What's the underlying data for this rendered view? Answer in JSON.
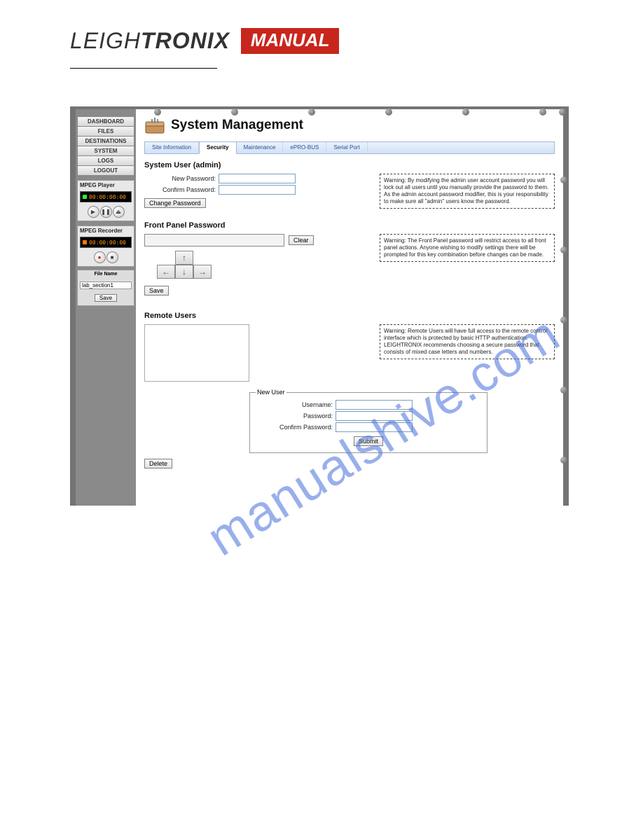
{
  "brand": {
    "thin": "LEIGH",
    "bold": "TRONIX",
    "badge": "MANUAL"
  },
  "watermark": "manualshive.com",
  "sidebar": {
    "nav": [
      "DASHBOARD",
      "FILES",
      "DESTINATIONS",
      "SYSTEM",
      "LOGS",
      "LOGOUT"
    ],
    "player": {
      "title": "MPEG Player",
      "time": "00:00:00:00",
      "controls": [
        "play",
        "pause",
        "eject"
      ]
    },
    "recorder": {
      "title": "MPEG Recorder",
      "time": "00:00:00:00",
      "controls": [
        "record",
        "stop"
      ]
    },
    "filebox": {
      "label": "File Name",
      "value": "lab_section1",
      "save": "Save"
    }
  },
  "page_title": "System Management",
  "tabs": [
    "Site Information",
    "Security",
    "Maintenance",
    "ePRO-BUS",
    "Serial Port"
  ],
  "active_tab": 1,
  "system_user": {
    "heading": "System User (admin)",
    "new_pw_label": "New Password:",
    "confirm_pw_label": "Confirm Password:",
    "change_btn": "Change Password",
    "warning": "Warning: By modifying the admin user account password you will lock out all users until you manually provide the password to them. As the admin account password modifier, this is your responsibility to make sure all \"admin\" users know the password."
  },
  "front_panel": {
    "heading": "Front Panel Password",
    "clear_btn": "Clear",
    "save_btn": "Save",
    "arrows": {
      "up": "↑",
      "down": "↓",
      "left": "←",
      "right": "→"
    },
    "warning": "Warning: The Front Panel password will restrict access to all front panel actions. Anyone wishing to modify settings there will be prompted for this key combination before changes can be made."
  },
  "remote_users": {
    "heading": "Remote Users",
    "warning": "Warning: Remote Users will have full access to the remote control interface which is protected by basic HTTP authentication. LEIGHTRONIX recommends choosing a secure password that consists of mixed case letters and numbers.",
    "fieldset_legend": "New User",
    "username_label": "Username:",
    "password_label": "Password:",
    "confirm_label": "Confirm Password:",
    "submit_btn": "Submit",
    "delete_btn": "Delete"
  }
}
